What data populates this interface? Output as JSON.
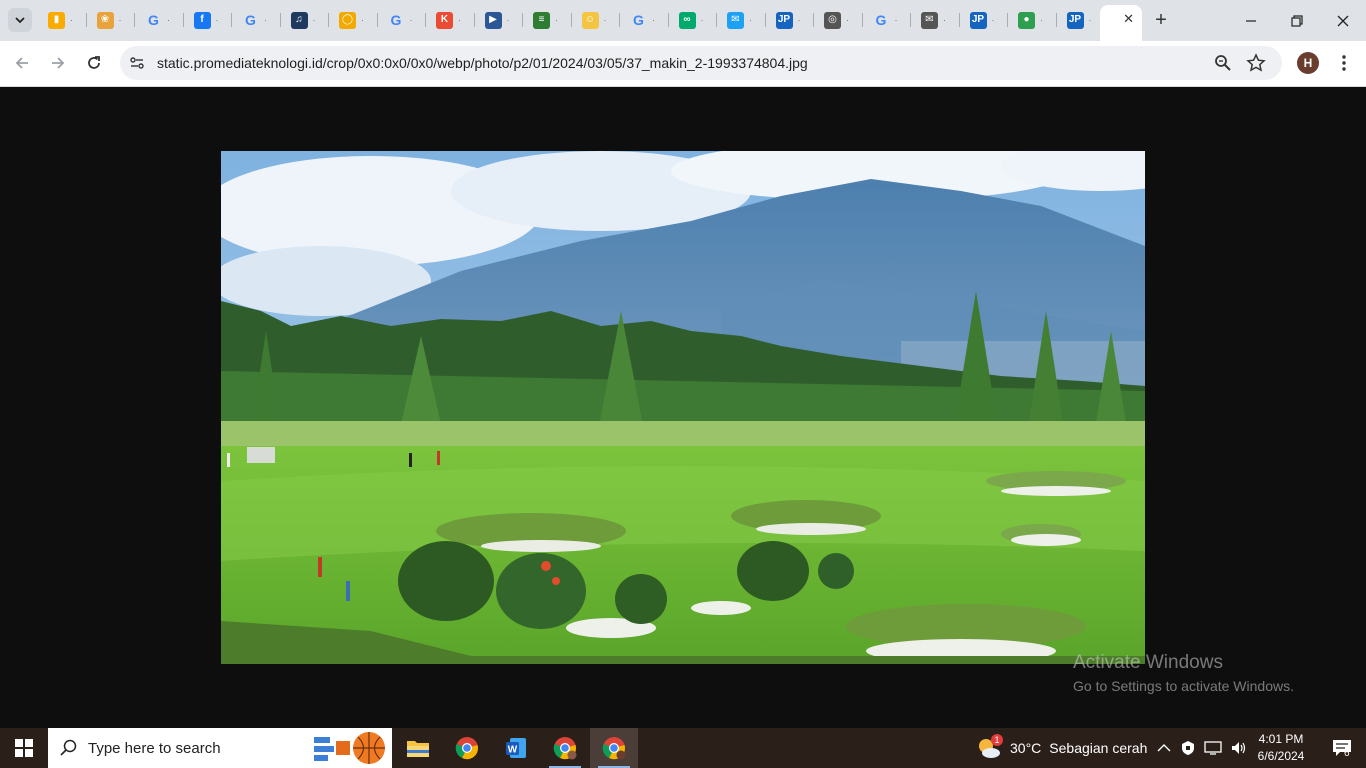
{
  "browser": {
    "tabs": [
      {
        "icon": "analytics-icon",
        "color": "#f9ab00"
      },
      {
        "icon": "lotus-icon",
        "color": "#e8a33d"
      },
      {
        "icon": "google-icon",
        "color": "#4285f4"
      },
      {
        "icon": "facebook-icon",
        "color": "#1877f2"
      },
      {
        "icon": "google-icon",
        "color": "#4285f4"
      },
      {
        "icon": "music-icon",
        "color": "#1e3a5f"
      },
      {
        "icon": "ring-icon",
        "color": "#f2a900"
      },
      {
        "icon": "google-icon",
        "color": "#4285f4"
      },
      {
        "icon": "kk-icon",
        "color": "#e94b35"
      },
      {
        "icon": "flag-icon",
        "color": "#2b5797"
      },
      {
        "icon": "document-icon",
        "color": "#2e7d32"
      },
      {
        "icon": "emoji-icon",
        "color": "#f4c542"
      },
      {
        "icon": "google-icon",
        "color": "#4285f4"
      },
      {
        "icon": "tripadvisor-icon",
        "color": "#00aa6c"
      },
      {
        "icon": "chat-icon",
        "color": "#1da1f2"
      },
      {
        "icon": "jp-icon",
        "color": "#1565c0"
      },
      {
        "icon": "compass-icon",
        "color": "#555555"
      },
      {
        "icon": "google-icon",
        "color": "#4285f4"
      },
      {
        "icon": "mail-icon",
        "color": "#555555"
      },
      {
        "icon": "jp-icon",
        "color": "#1565c0"
      },
      {
        "icon": "circle-icon",
        "color": "#2e9e4f"
      },
      {
        "icon": "jp-icon",
        "color": "#1565c0"
      }
    ],
    "active_tab": {
      "label": ""
    },
    "url": "static.promediateknologi.id/crop/0x0:0x0/0x0/webp/photo/p2/01/2024/03/05/37_makin_2-1993374804.jpg",
    "profile_initial": "H"
  },
  "content": {
    "image_subject": "golf-course-photo"
  },
  "watermark": {
    "line1": "Activate Windows",
    "line2": "Go to Settings to activate Windows."
  },
  "taskbar": {
    "search_placeholder": "Type here to search",
    "weather_temp": "30°C",
    "weather_desc": "Sebagian cerah",
    "time": "4:01 PM",
    "date": "6/6/2024",
    "notification_count": "6",
    "weather_badge": "1"
  }
}
